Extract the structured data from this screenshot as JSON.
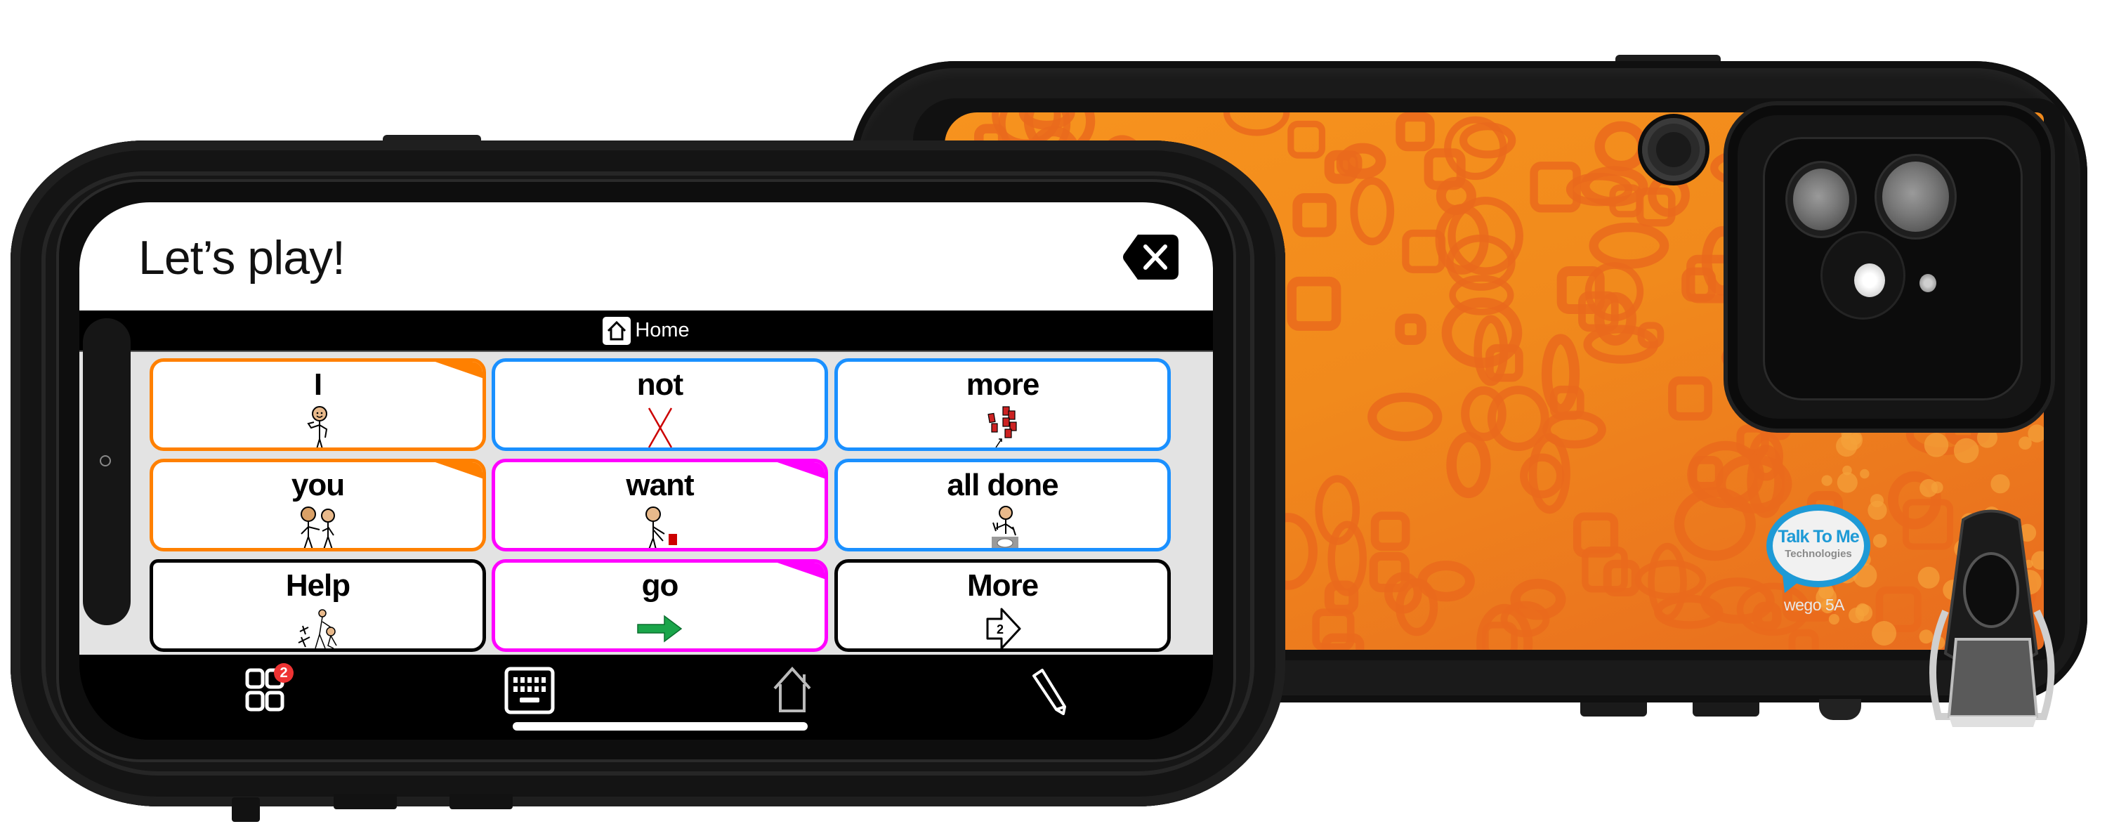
{
  "screen": {
    "message_bar": {
      "text": "Let’s play!",
      "clear_icon": "backspace-x-icon"
    },
    "breadcrumb": {
      "icon": "home-icon",
      "label": "Home"
    },
    "grid": {
      "rows": 3,
      "cols": 3,
      "cells": [
        {
          "label": "I",
          "symbol": "person-pointing-self",
          "border_color": "#ff8000",
          "corner_color": "#ff8000",
          "type": "word"
        },
        {
          "label": "not",
          "symbol": "red-x",
          "border_color": "#1a90ff",
          "corner_color": null,
          "type": "word"
        },
        {
          "label": "more",
          "symbol": "red-blocks-more",
          "border_color": "#1a90ff",
          "corner_color": null,
          "type": "word"
        },
        {
          "label": "you",
          "symbol": "person-pointing-other",
          "border_color": "#ff8000",
          "corner_color": "#ff8000",
          "type": "word"
        },
        {
          "label": "want",
          "symbol": "person-reaching-block",
          "border_color": "#ff00ff",
          "corner_color": "#ff00ff",
          "type": "word"
        },
        {
          "label": "all done",
          "symbol": "person-finished-plate",
          "border_color": "#1a90ff",
          "corner_color": null,
          "type": "word"
        },
        {
          "label": "Help",
          "symbol": "people-helping",
          "border_color": "#000000",
          "corner_color": null,
          "type": "folder"
        },
        {
          "label": "go",
          "symbol": "green-arrow-right",
          "border_color": "#ff00ff",
          "corner_color": "#ff00ff",
          "type": "word"
        },
        {
          "label": "More",
          "symbol": "page-arrow-2",
          "border_color": "#000000",
          "corner_color": null,
          "type": "word",
          "page_number": "2"
        }
      ]
    },
    "bottom_nav": [
      {
        "name": "grid-menu",
        "icon": "grid-icon",
        "badge": "2"
      },
      {
        "name": "keyboard",
        "icon": "keyboard-icon"
      },
      {
        "name": "home",
        "icon": "home-outline-icon"
      },
      {
        "name": "edit",
        "icon": "pencil-icon"
      }
    ]
  },
  "back_device": {
    "brand_title": "Talk To Me",
    "brand_subtitle": "Technologies",
    "model": "wego 5A",
    "colors": {
      "panel": "#f7931e",
      "pattern": "#ea6a1c",
      "logo_blue": "#1e9ad6"
    }
  }
}
